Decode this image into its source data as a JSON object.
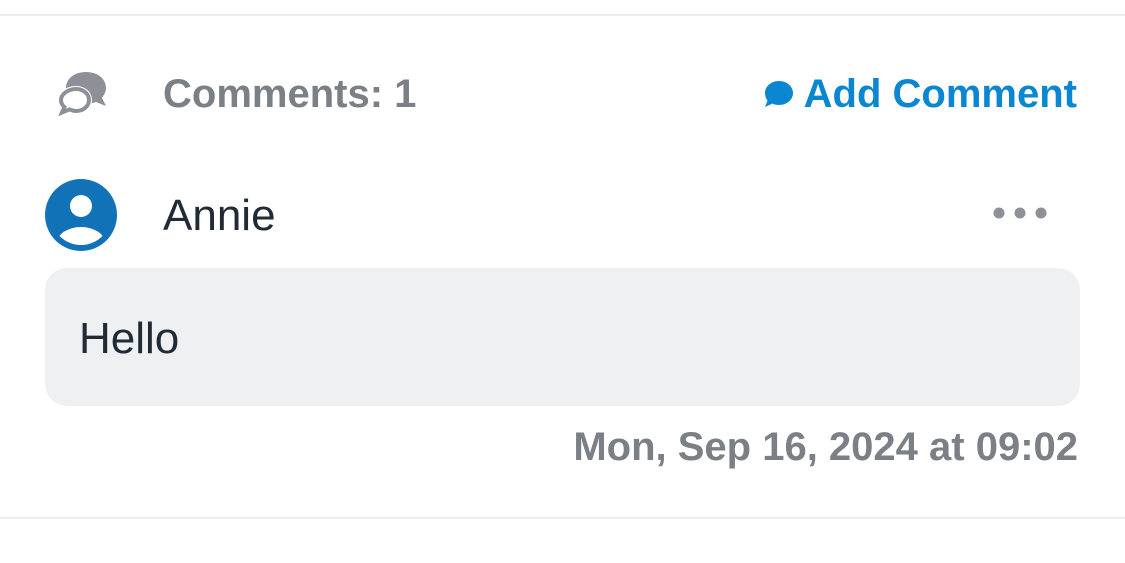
{
  "header": {
    "icon": "comments-icon",
    "count_label": "Comments: 1",
    "add_comment_label": "Add Comment",
    "add_comment_icon": "speech-bubble-icon"
  },
  "comments": [
    {
      "author": "Annie",
      "avatar_icon": "user-avatar-icon",
      "menu_icon": "more-options-icon",
      "text": "Hello",
      "timestamp": "Mon, Sep 16, 2024 at 09:02"
    }
  ],
  "colors": {
    "accent": "#0b87d2",
    "avatar": "#1172b8",
    "muted_text": "#7b8087",
    "body_text": "#202b36",
    "bubble_bg": "#eff0f2",
    "divider": "#eaecef"
  }
}
